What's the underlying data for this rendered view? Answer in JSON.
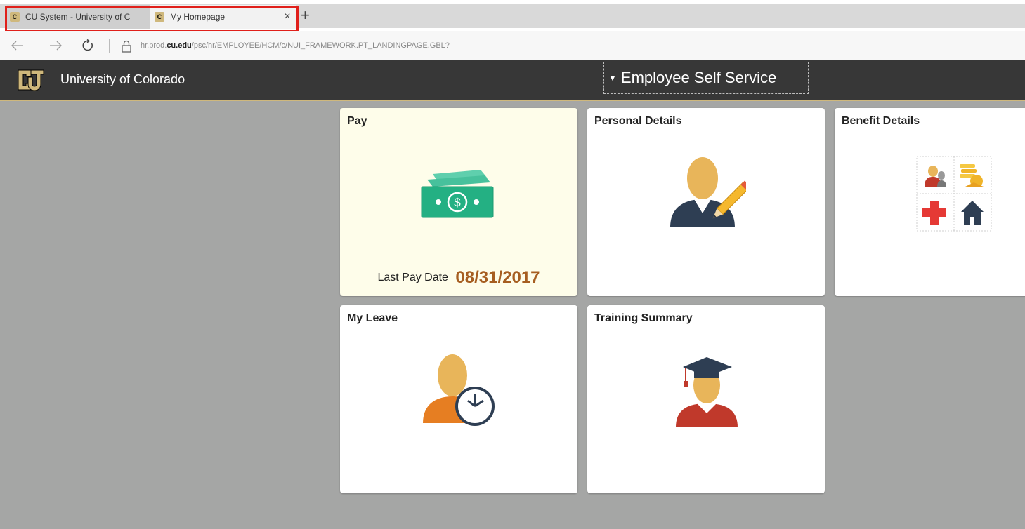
{
  "browser": {
    "tabs": [
      {
        "title": "CU System - University of C",
        "icon": "cu-favicon-icon"
      },
      {
        "title": "My Homepage",
        "icon": "cu-favicon-icon",
        "close": "×"
      }
    ],
    "new_tab": "+",
    "url_prefix": "hr.prod.",
    "url_domain": "cu.edu",
    "url_path": "/psc/hr/EMPLOYEE/HCM/c/NUI_FRAMEWORK.PT_LANDINGPAGE.GBL?"
  },
  "header": {
    "org_name": "University of Colorado",
    "homepage_selector": "Employee Self Service",
    "brand_gold": "#cfb87c",
    "bar_color": "#373737"
  },
  "tiles": [
    {
      "title": "Pay",
      "icon": "money-icon",
      "footer_label": "Last Pay Date",
      "footer_value": "08/31/2017"
    },
    {
      "title": "Personal Details",
      "icon": "person-edit-icon"
    },
    {
      "title": "Benefit Details",
      "icon": "benefits-icon"
    },
    {
      "title": "My Leave",
      "icon": "person-clock-icon"
    },
    {
      "title": "Training Summary",
      "icon": "graduate-icon"
    }
  ],
  "colors": {
    "highlight_box": "#e0201b",
    "pay_tile_bg": "#fefdea",
    "pay_date": "#a65e21",
    "page_bg": "#a5a6a5"
  }
}
